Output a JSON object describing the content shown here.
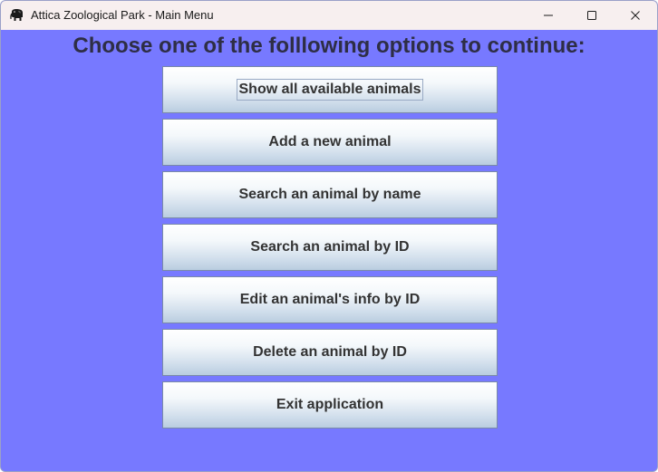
{
  "window": {
    "title": "Attica Zoological Park - Main Menu",
    "icon": "elephant-icon",
    "controls": [
      "minimize-icon",
      "maximize-icon",
      "close-icon"
    ]
  },
  "colors": {
    "background": "#7779ff",
    "titlebar": "#f7efef",
    "heading_text": "#2e2e45",
    "button_text": "#333333"
  },
  "main": {
    "heading": "Choose one of the folllowing options to continue:",
    "buttons": [
      {
        "label": "Show all available animals",
        "focused": true
      },
      {
        "label": "Add a new animal",
        "focused": false
      },
      {
        "label": "Search an animal by name",
        "focused": false
      },
      {
        "label": "Search an animal by ID",
        "focused": false
      },
      {
        "label": "Edit an animal's info by ID",
        "focused": false
      },
      {
        "label": "Delete an animal by ID",
        "focused": false
      },
      {
        "label": "Exit application",
        "focused": false
      }
    ]
  }
}
